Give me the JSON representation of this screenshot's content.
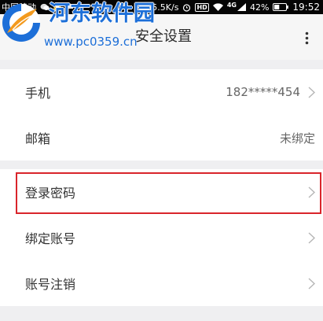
{
  "status_bar": {
    "carrier": "中国移动",
    "net_speed": "55.5K/s",
    "hd_badge": "HD",
    "network_type": "4G",
    "battery_percent": "42%",
    "time": "19:52",
    "icons": [
      "wechat-icon",
      "app-notification-icon",
      "message-icon",
      "alarm-icon",
      "wifi-icon",
      "signal-icon",
      "battery-icon"
    ]
  },
  "watermark": {
    "site_name": "河东软件园",
    "url": "www.pc0359.cn",
    "logo_icon": "site-logo-icon"
  },
  "header": {
    "title": "安全设置",
    "menu_icon": "more-vertical-icon"
  },
  "account_section": {
    "rows": [
      {
        "label": "手机",
        "value": "182*****454",
        "chevron_icon": "chevron-right-icon"
      },
      {
        "label": "邮箱",
        "value": "未绑定"
      }
    ]
  },
  "security_section": {
    "rows": [
      {
        "label": "登录密码",
        "chevron_icon": "chevron-right-icon",
        "highlighted": true
      },
      {
        "label": "绑定账号",
        "chevron_icon": "chevron-right-icon"
      },
      {
        "label": "账号注销",
        "chevron_icon": "chevron-right-icon"
      }
    ]
  },
  "colors": {
    "status_bar_bg": "#050505",
    "page_bg": "#efeff1",
    "header_bg": "#f6f6f6",
    "row_bg": "#ffffff",
    "label_text": "#333333",
    "value_text": "#666666",
    "chevron": "#b5b5b5",
    "highlight_border": "#d9252b",
    "watermark_blue": "#1d6fd8",
    "watermark_orange": "#f39a1e"
  }
}
